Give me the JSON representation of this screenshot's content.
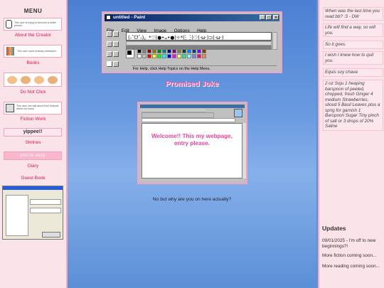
{
  "left_menu": {
    "title": "MENU",
    "items": [
      {
        "label": "About the Creator",
        "stamp": "This user is trying to become a better person"
      },
      {
        "label": "Books",
        "stamp": "This user loves fictional characters"
      },
      {
        "label": "Do Not Click",
        "stamp": ""
      },
      {
        "label": "Fiction Work",
        "stamp": "This user can talk about their fictional others for hours"
      },
      {
        "label": "Shrines",
        "stamp": "yippee!!"
      },
      {
        "label": "Diary",
        "stamp": "you're sexy"
      },
      {
        "label": "Guest Book",
        "stamp": ""
      }
    ]
  },
  "paint": {
    "title": "untitled - Paint",
    "menus": [
      "File",
      "Edit",
      "View",
      "Image",
      "Options",
      "Help"
    ],
    "canvas_text": "(˶ˆᗜˆ˵)。*♡(●•ᴗ•●)✧*(‧̥́‿‧̥̀)♡(·ω·)⊃(·ω·)",
    "status": "For Help, click Help Topics on the Help Menu.",
    "colors": [
      "#000000",
      "#808080",
      "#800000",
      "#808000",
      "#008000",
      "#008080",
      "#000080",
      "#800080",
      "#808040",
      "#004040",
      "#0080ff",
      "#004080",
      "#8000ff",
      "#804000",
      "#ffffff",
      "#c0c0c0",
      "#ff0000",
      "#ffff00",
      "#00ff00",
      "#00ffff",
      "#0000ff",
      "#ff00ff",
      "#ffff80",
      "#00ff80",
      "#80ffff",
      "#8080ff",
      "#ff0080",
      "#ff8040"
    ]
  },
  "promised_joke": "Promised Joke",
  "welcome": "Welcome!! This my webpage, entry please.",
  "why_text": "No but why are you on here actually?",
  "notes": [
    "When was the last time you read bb? :3 - DW",
    "Life will find a way, so will you.",
    "So it goes.",
    "I wish I knew how to quit you.",
    "Equis soy chava",
    "2 oz Soju 1 heaping barspoon of peeled, chopped, fresh Ginger 4 medium Strawberries, sliced 5 Basil Leaves plus a sprig for garnish 1 Barspoon Sugar Tiny pinch of salt or 3 drops of 20% Saline"
  ],
  "updates": {
    "title": "Updates",
    "items": [
      "09/01/2025 - I'm off to new beginnings?!",
      "More fiction coming soon...",
      "More reading coming soon..."
    ]
  },
  "colors": {
    "accent": "#d4145a",
    "sidebar_bg": "#fbe3ea",
    "border": "#f4a9bf"
  }
}
